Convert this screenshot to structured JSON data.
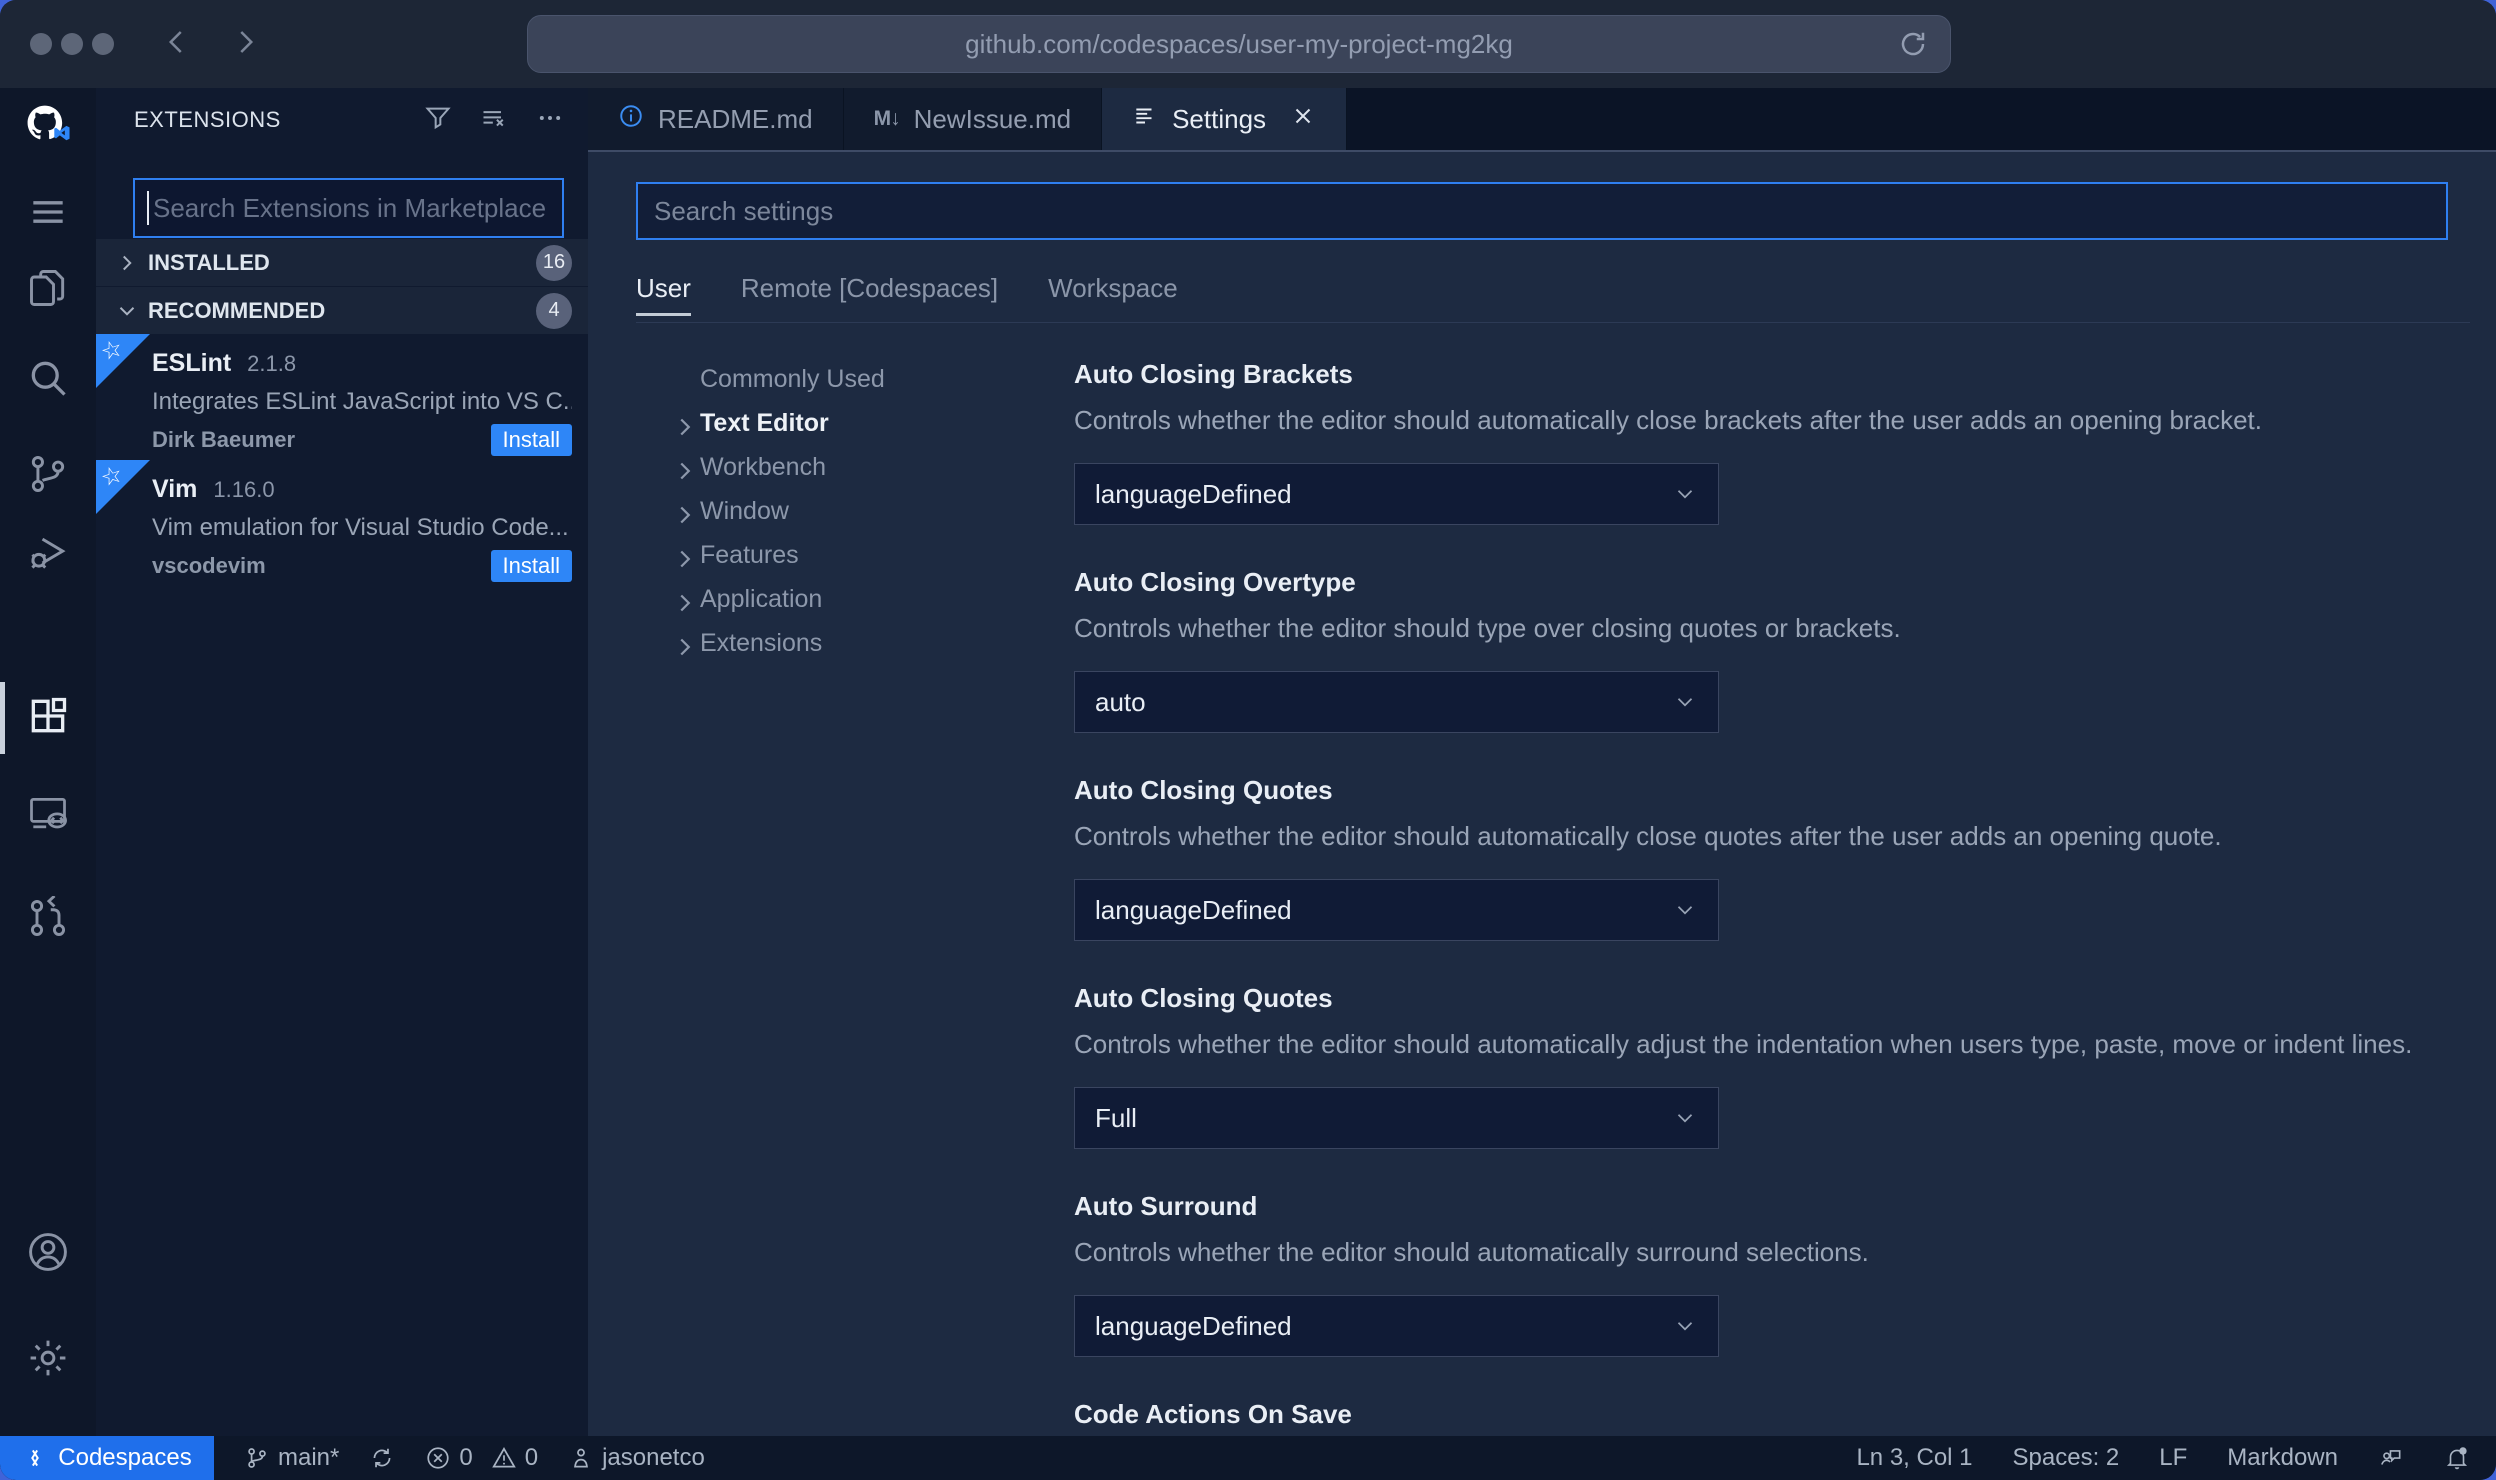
{
  "browser": {
    "url": "github.com/codespaces/user-my-project-mg2kg"
  },
  "activity_bar": {
    "items": [
      "github-logo",
      "menu",
      "explorer",
      "search",
      "source-control",
      "run-debug",
      "extensions",
      "remote-explorer",
      "github-pull-requests",
      "account",
      "settings-gear"
    ],
    "active_item": "extensions"
  },
  "sidebar": {
    "title": "EXTENSIONS",
    "search_placeholder": "Search Extensions in Marketplace",
    "ribbon_star": "☆",
    "sections": [
      {
        "label": "INSTALLED",
        "count": "16"
      },
      {
        "label": "RECOMMENDED",
        "count": "4"
      }
    ],
    "extensions": [
      {
        "name": "ESLint",
        "version": "2.1.8",
        "description": "Integrates ESLint JavaScript into VS C...",
        "author": "Dirk Baeumer",
        "action": "Install"
      },
      {
        "name": "Vim",
        "version": "1.16.0",
        "description": "Vim emulation for Visual Studio Code...",
        "author": "vscodevim",
        "action": "Install"
      }
    ]
  },
  "tabs": [
    {
      "label": "README.md",
      "icon": "info-icon"
    },
    {
      "label": "NewIssue.md",
      "icon": "markdown-icon",
      "icon_text": "M↓"
    },
    {
      "label": "Settings",
      "icon": "settings-list-icon",
      "closable": true
    }
  ],
  "settings": {
    "search_placeholder": "Search settings",
    "scopes": [
      {
        "label": "User",
        "active": true
      },
      {
        "label": "Remote [Codespaces]"
      },
      {
        "label": "Workspace"
      }
    ],
    "tree": [
      {
        "label": "Commonly Used",
        "chevron": false
      },
      {
        "label": "Text Editor",
        "chevron": true,
        "active": true
      },
      {
        "label": "Workbench",
        "chevron": true
      },
      {
        "label": "Window",
        "chevron": true
      },
      {
        "label": "Features",
        "chevron": true
      },
      {
        "label": "Application",
        "chevron": true
      },
      {
        "label": "Extensions",
        "chevron": true
      }
    ],
    "entries": [
      {
        "title": "Auto Closing Brackets",
        "description": "Controls whether the editor should automatically close brackets after the user adds an opening bracket.",
        "value": "languageDefined"
      },
      {
        "title": "Auto Closing Overtype",
        "description": "Controls whether the editor should type over closing quotes or brackets.",
        "value": "auto"
      },
      {
        "title": "Auto Closing Quotes",
        "description": "Controls whether the editor should automatically close quotes after the user adds an opening quote.",
        "value": "languageDefined"
      },
      {
        "title": "Auto Closing Quotes",
        "description": "Controls whether the editor should automatically adjust the indentation when users type, paste, move or indent lines.",
        "value": "Full"
      },
      {
        "title": "Auto Surround",
        "description": "Controls whether the editor should automatically surround selections.",
        "value": "languageDefined"
      },
      {
        "title": "Code Actions On Save"
      }
    ]
  },
  "status_bar": {
    "codespaces_label": "Codespaces",
    "branch": "main*",
    "errors": "0",
    "warnings": "0",
    "user": "jasonetco",
    "cursor": "Ln 3, Col 1",
    "indent": "Spaces: 2",
    "eol": "LF",
    "language": "Markdown"
  },
  "colors": {
    "accent": "#2f7ff0",
    "install_button": "#2e86f7",
    "codespaces_chip": "#1f6feb",
    "ribbon": "#2e86f7"
  }
}
